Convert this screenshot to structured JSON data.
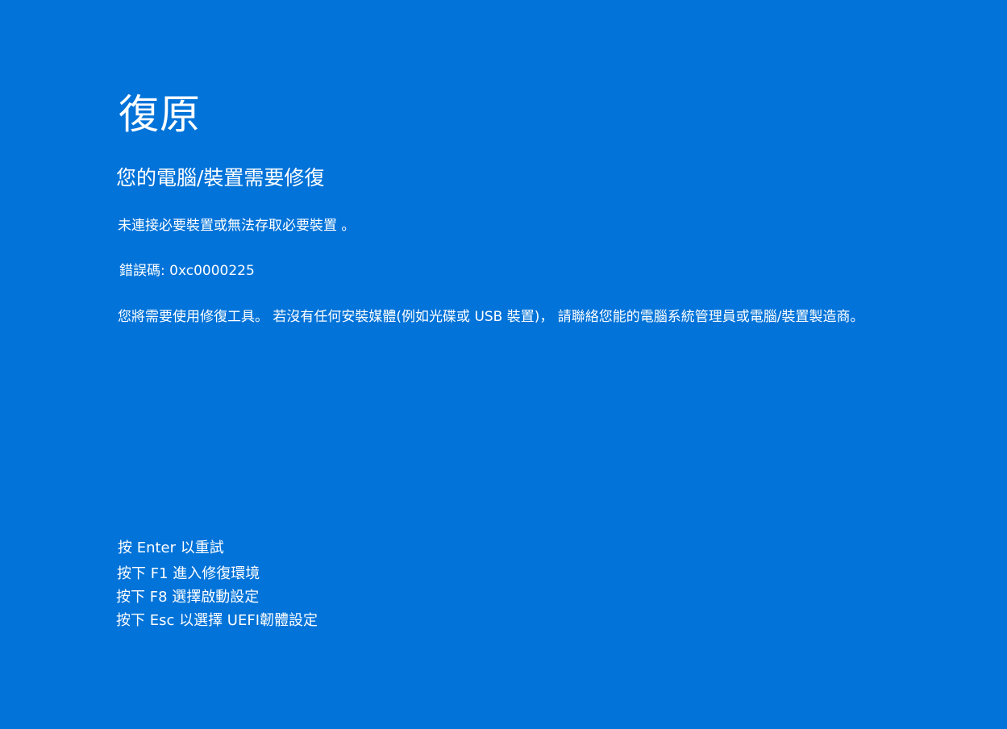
{
  "colors": {
    "background": "#0173d9",
    "text": "#ffffff"
  },
  "title": "復原",
  "subtitle": "您的電腦/裝置需要修復",
  "message": "未連接必要裝置或無法存取必要裝置 。",
  "error": {
    "label": "錯誤碼:",
    "code": "0xc0000225"
  },
  "advice": "您將需要使用修復工具。 若沒有任何安裝媒體(例如光碟或 USB 裝置)， 請聯絡您能的電腦系統管理員或電腦/裝置製造商。",
  "key_options": [
    {
      "text": "按 Enter 以重試"
    },
    {
      "text": "按下 F1 進入修復環境"
    },
    {
      "text": "按下 F8 選擇啟動設定"
    },
    {
      "text": "按下 Esc 以選擇 UEFI韌體設定"
    }
  ]
}
